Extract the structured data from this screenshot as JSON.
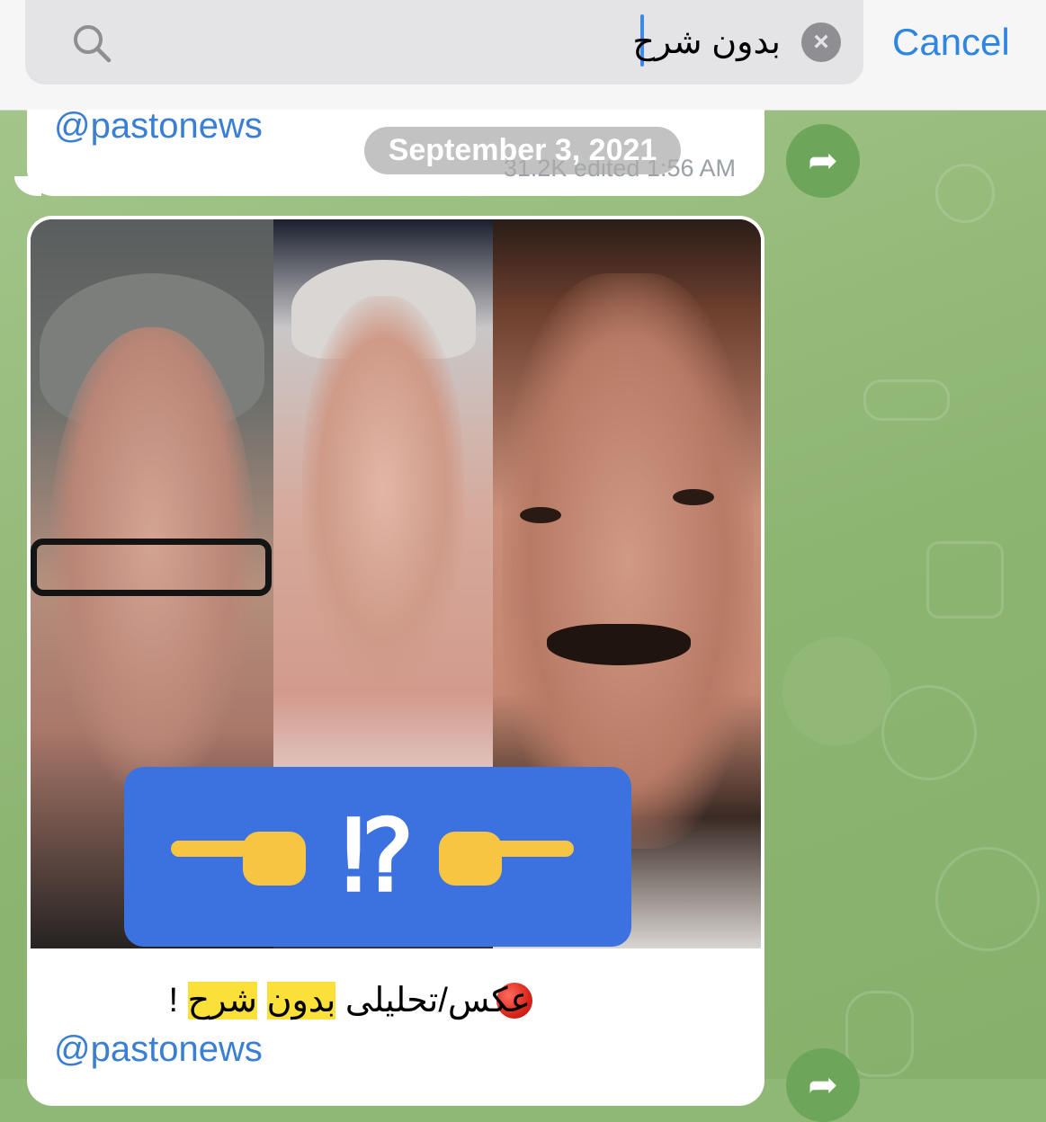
{
  "search": {
    "query": "بدون شرح",
    "cancel_label": "Cancel"
  },
  "messages": [
    {
      "handle": "@pastonews",
      "meta": "31.2K edited 1:56 AM"
    },
    {
      "caption_prefix": "عکس/تحلیلی",
      "caption_hl1": "بدون",
      "caption_hl2": "شرح",
      "caption_suffix": "!",
      "handle": "@pastonews",
      "sticker_text": "⁉"
    }
  ],
  "date_pill": "September 3, 2021",
  "colors": {
    "accent": "#2f86e0",
    "highlight": "#fbe03a",
    "chat_background": "#8db572",
    "forward_button": "#6da65a"
  },
  "icons": [
    "search-icon",
    "clear-icon",
    "forward-icon",
    "red-circle-icon",
    "pointing-hand-icon"
  ]
}
